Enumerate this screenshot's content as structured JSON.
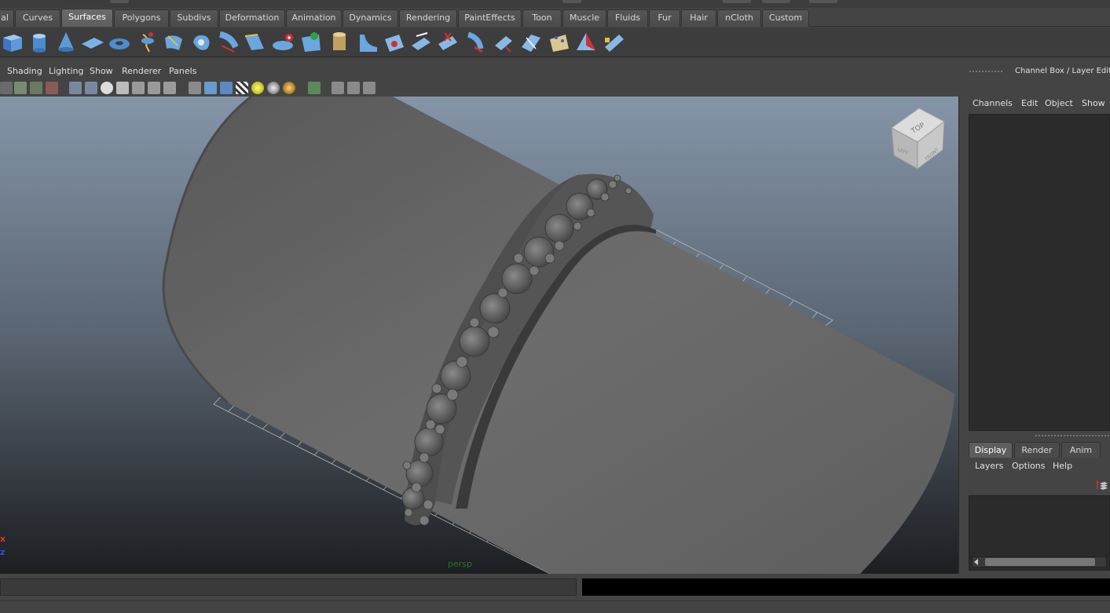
{
  "shelf": {
    "tabs": [
      {
        "label": "al",
        "active": false
      },
      {
        "label": "Curves",
        "active": false
      },
      {
        "label": "Surfaces",
        "active": true
      },
      {
        "label": "Polygons",
        "active": false
      },
      {
        "label": "Subdivs",
        "active": false
      },
      {
        "label": "Deformation",
        "active": false
      },
      {
        "label": "Animation",
        "active": false
      },
      {
        "label": "Dynamics",
        "active": false
      },
      {
        "label": "Rendering",
        "active": false
      },
      {
        "label": "PaintEffects",
        "active": false
      },
      {
        "label": "Toon",
        "active": false
      },
      {
        "label": "Muscle",
        "active": false
      },
      {
        "label": "Fluids",
        "active": false
      },
      {
        "label": "Fur",
        "active": false
      },
      {
        "label": "Hair",
        "active": false
      },
      {
        "label": "nCloth",
        "active": false
      },
      {
        "label": "Custom",
        "active": false
      }
    ],
    "icons": [
      "nurbs-cube-icon",
      "nurbs-cylinder-icon",
      "nurbs-cone-icon",
      "nurbs-plane-icon",
      "nurbs-torus-icon",
      "revolve-icon",
      "loft-icon",
      "planar-icon",
      "extrude-icon",
      "birail-icon",
      "boundary-icon",
      "square-surface-icon",
      "bevel-icon",
      "bevel-plus-icon",
      "intersect-icon",
      "project-curve-icon",
      "trim-icon",
      "untrim-icon",
      "attach-icon",
      "detach-icon",
      "align-icon",
      "open-close-icon",
      "insert-isoparm-icon",
      "extend-icon",
      "offset-icon",
      "rebuild-icon",
      "reverse-direction-icon",
      "sculpt-icon",
      "fillet-icon"
    ]
  },
  "panel": {
    "menus": [
      "Shading",
      "Lighting",
      "Show",
      "Renderer",
      "Panels"
    ],
    "camera_label": "persp",
    "axis_x": "x",
    "axis_z": "z",
    "view_cube": {
      "top": "TOP",
      "left": "LEFT",
      "front": "FRONT"
    }
  },
  "channel_box": {
    "title": "Channel Box / Layer Editor",
    "menus": [
      "Channels",
      "Edit",
      "Object",
      "Show"
    ]
  },
  "layer_editor": {
    "tabs": [
      {
        "label": "Display",
        "active": true
      },
      {
        "label": "Render",
        "active": false
      },
      {
        "label": "Anim",
        "active": false
      }
    ],
    "menus": [
      "Layers",
      "Options",
      "Help"
    ]
  },
  "colors": {
    "viewport_top": "#8595a8",
    "viewport_bottom": "#1c1e21",
    "model_gray": "#6a6a6a"
  }
}
